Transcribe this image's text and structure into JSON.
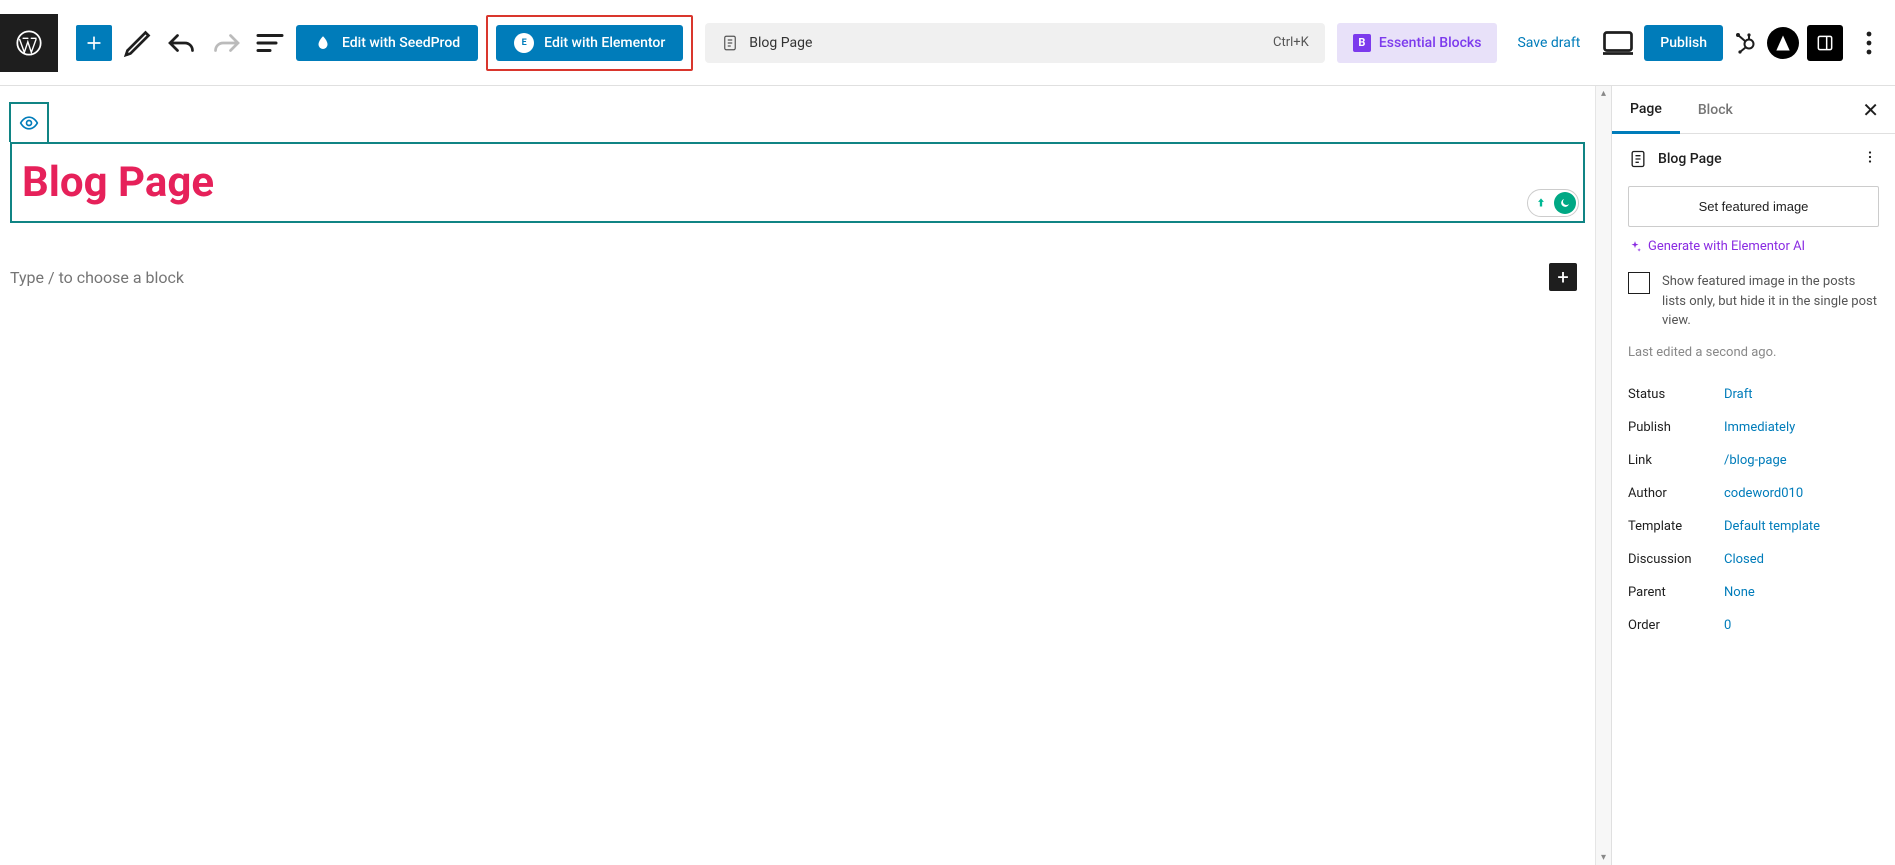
{
  "toolbar": {
    "seedprod_label": "Edit with SeedProd",
    "elementor_label": "Edit with Elementor",
    "doc_title": "Blog Page",
    "shortcut": "Ctrl+K",
    "essential_label": "Essential Blocks",
    "save_draft_label": "Save draft",
    "publish_label": "Publish"
  },
  "canvas": {
    "title": "Blog Page",
    "placeholder": "Type / to choose a block"
  },
  "sidebar": {
    "tabs": {
      "page": "Page",
      "block": "Block"
    },
    "page_name": "Blog Page",
    "featured_btn": "Set featured image",
    "gen_ai": "Generate with Elementor AI",
    "featured_checkbox": "Show featured image in the posts lists only, but hide it in the single post view.",
    "last_edited": "Last edited a second ago.",
    "meta": {
      "status": {
        "label": "Status",
        "value": "Draft"
      },
      "publish": {
        "label": "Publish",
        "value": "Immediately"
      },
      "link": {
        "label": "Link",
        "value": "/blog-page"
      },
      "author": {
        "label": "Author",
        "value": "codeword010"
      },
      "template": {
        "label": "Template",
        "value": "Default template"
      },
      "discussion": {
        "label": "Discussion",
        "value": "Closed"
      },
      "parent": {
        "label": "Parent",
        "value": "None"
      },
      "order": {
        "label": "Order",
        "value": "0"
      }
    }
  }
}
